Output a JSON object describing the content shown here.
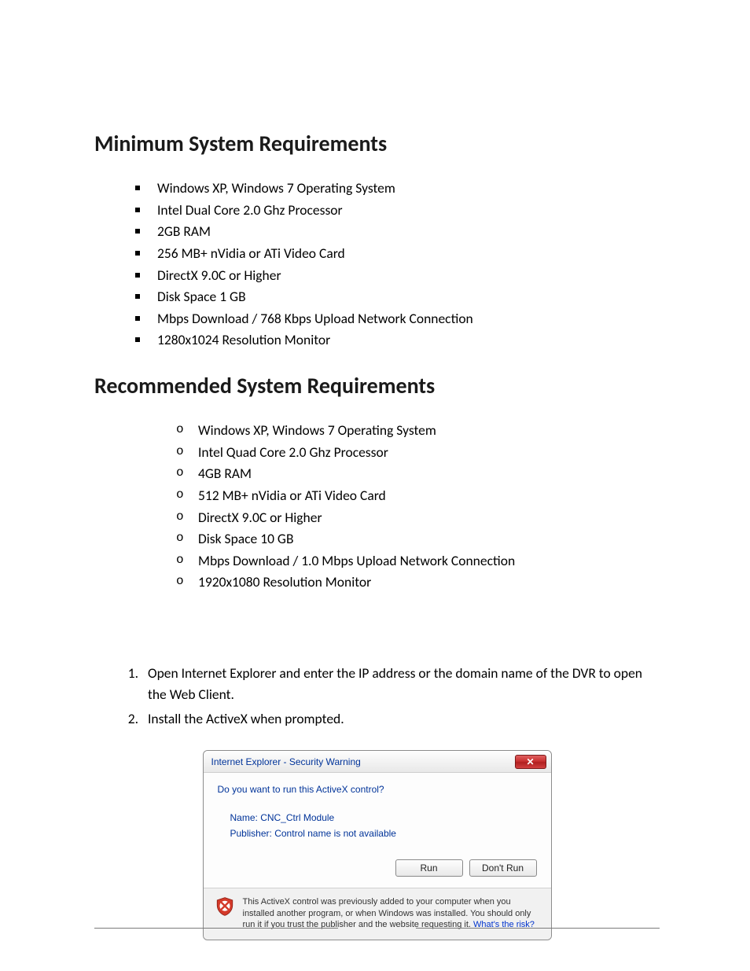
{
  "headings": {
    "minimum": "Minimum System Requirements",
    "recommended": "Recommended System Requirements"
  },
  "minimum_reqs": [
    "Windows XP, Windows 7 Operating System",
    "Intel Dual Core 2.0 Ghz Processor",
    "2GB RAM",
    "256 MB+ nVidia or ATi Video Card",
    "DirectX 9.0C or Higher",
    "Disk Space 1 GB",
    "Mbps Download / 768 Kbps Upload Network Connection",
    "1280x1024 Resolution Monitor"
  ],
  "recommended_reqs": [
    "Windows XP, Windows 7 Operating System",
    "Intel Quad Core 2.0 Ghz Processor",
    "4GB RAM",
    "512 MB+ nVidia or ATi Video Card",
    "DirectX 9.0C or Higher",
    "Disk Space 10 GB",
    "Mbps Download / 1.0 Mbps Upload Network Connection",
    "1920x1080 Resolution Monitor"
  ],
  "steps": [
    "Open Internet Explorer and enter the IP address or the domain name of the DVR to open the Web Client.",
    "Install the ActiveX when prompted."
  ],
  "dialog": {
    "title": "Internet Explorer - Security Warning",
    "question": "Do you want to run this ActiveX control?",
    "name_label": "Name:",
    "name_value": "CNC_Ctrl Module",
    "publisher_label": "Publisher:",
    "publisher_value": "Control name is not available",
    "run": "Run",
    "dont_run": "Don't Run",
    "footer_text": "This ActiveX control was previously added to your computer when you installed another program, or when Windows was installed. You should only run it if you trust the publisher and the website requesting it.",
    "footer_link": "What's the risk?"
  }
}
